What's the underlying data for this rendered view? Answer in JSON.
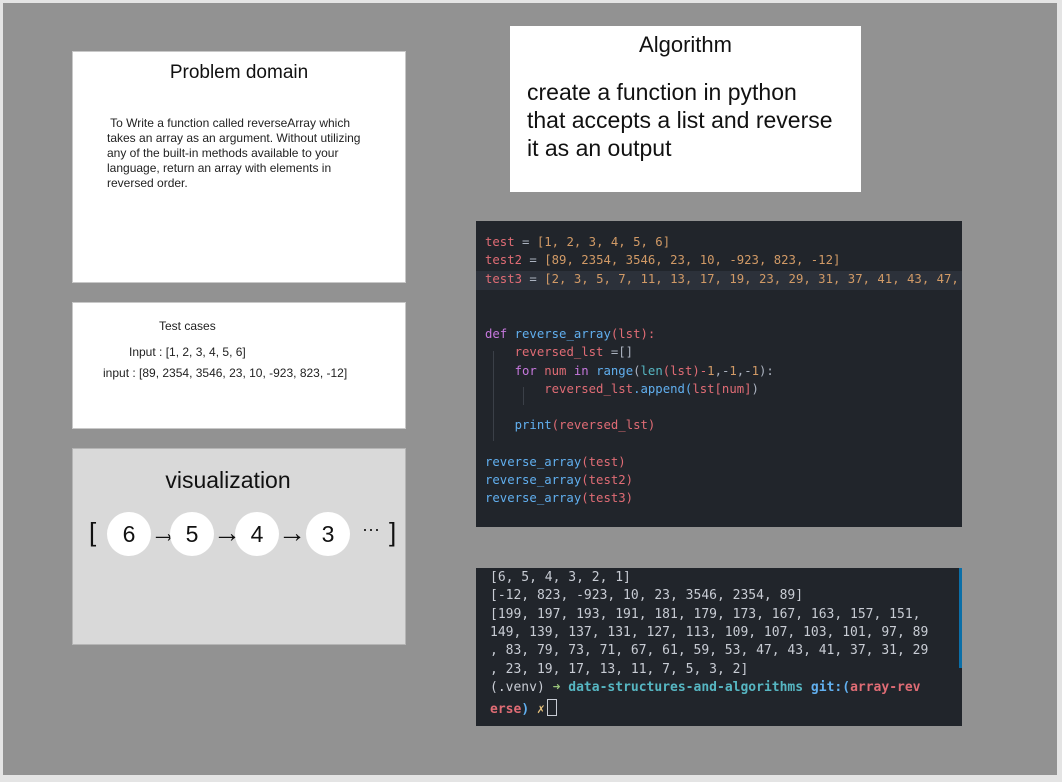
{
  "problem": {
    "title": "Problem domain",
    "lines": [
      " To Write a function called reverseArray which",
      "takes an array as an argument. Without utilizing",
      "any of the built-in methods available to your",
      "language, return an array with elements in",
      "reversed order."
    ]
  },
  "tests": {
    "title": "Test cases",
    "line1": "Input : [1, 2, 3, 4, 5, 6]",
    "line2": "input : [89, 2354, 3546, 23, 10, -923, 823, -12]"
  },
  "visualization": {
    "title": "visualization",
    "open_bracket": "[",
    "close_bracket": "]",
    "nodes": [
      "6",
      "5",
      "4",
      "3"
    ],
    "arrow": "→",
    "ellipsis": "···"
  },
  "algorithm": {
    "title": "Algorithm",
    "lines": [
      "create a function in python",
      "that accepts a list and reverse",
      "it as an output"
    ]
  },
  "code": {
    "test_name": "test",
    "test_values": "[1, 2, 3, 4, 5, 6]",
    "test2_name": "test2",
    "test2_values": "[89, 2354, 3546, 23, 10, -923, 823, -12]",
    "test3_name": "test3",
    "test3_values": "[2, 3, 5, 7, 11, 13, 17, 19, 23, 29, 31, 37, 41, 43, 47,",
    "def_kw": "def",
    "func_name": "reverse_array",
    "param": "(lst):",
    "reversed_init_var": "reversed_lst",
    "reversed_init_rest": " =[]",
    "for_kw": "for",
    "loop_var": "num",
    "in_kw": "in",
    "range_fn": "range",
    "len_fn": "len",
    "range_args_a": "(lst)-",
    "range_args_b": "1",
    "range_args_c": ",-",
    "range_args_d": "1",
    "range_args_e": ",-",
    "range_args_f": "1",
    "range_args_g": "):",
    "append_target": "reversed_lst",
    "append_call": ".append(",
    "append_arg": "lst[num]",
    "append_close": ")",
    "print_fn": "print",
    "print_arg": "(reversed_lst)",
    "call1_fn": "reverse_array",
    "call1_arg": "(test)",
    "call2_fn": "reverse_array",
    "call2_arg": "(test2)",
    "call3_fn": "reverse_array",
    "call3_arg": "(test3)"
  },
  "terminal": {
    "lines": [
      "[6, 5, 4, 3, 2, 1]",
      "[-12, 823, -923, 10, 23, 3546, 2354, 89]",
      "[199, 197, 193, 191, 181, 179, 173, 167, 163, 157, 151,",
      "149, 139, 137, 131, 127, 113, 109, 107, 103, 101, 97, 89",
      ", 83, 79, 73, 71, 67, 61, 59, 53, 47, 43, 41, 37, 31, 29",
      ", 23, 19, 17, 13, 11, 7, 5, 3, 2]"
    ],
    "venv": "(.venv)",
    "arrow": "➜",
    "dir": "data-structures-and-algorithms",
    "git": "git:(",
    "branch_a": "array-rev",
    "branch_b": "erse",
    "git_close": ")",
    "x_mark": "✗"
  },
  "colors": {
    "board": "#929292",
    "editor_bg": "#21252b",
    "keyword": "#c678dd",
    "function": "#61afef",
    "variable": "#e06c75",
    "number": "#d19a66"
  }
}
